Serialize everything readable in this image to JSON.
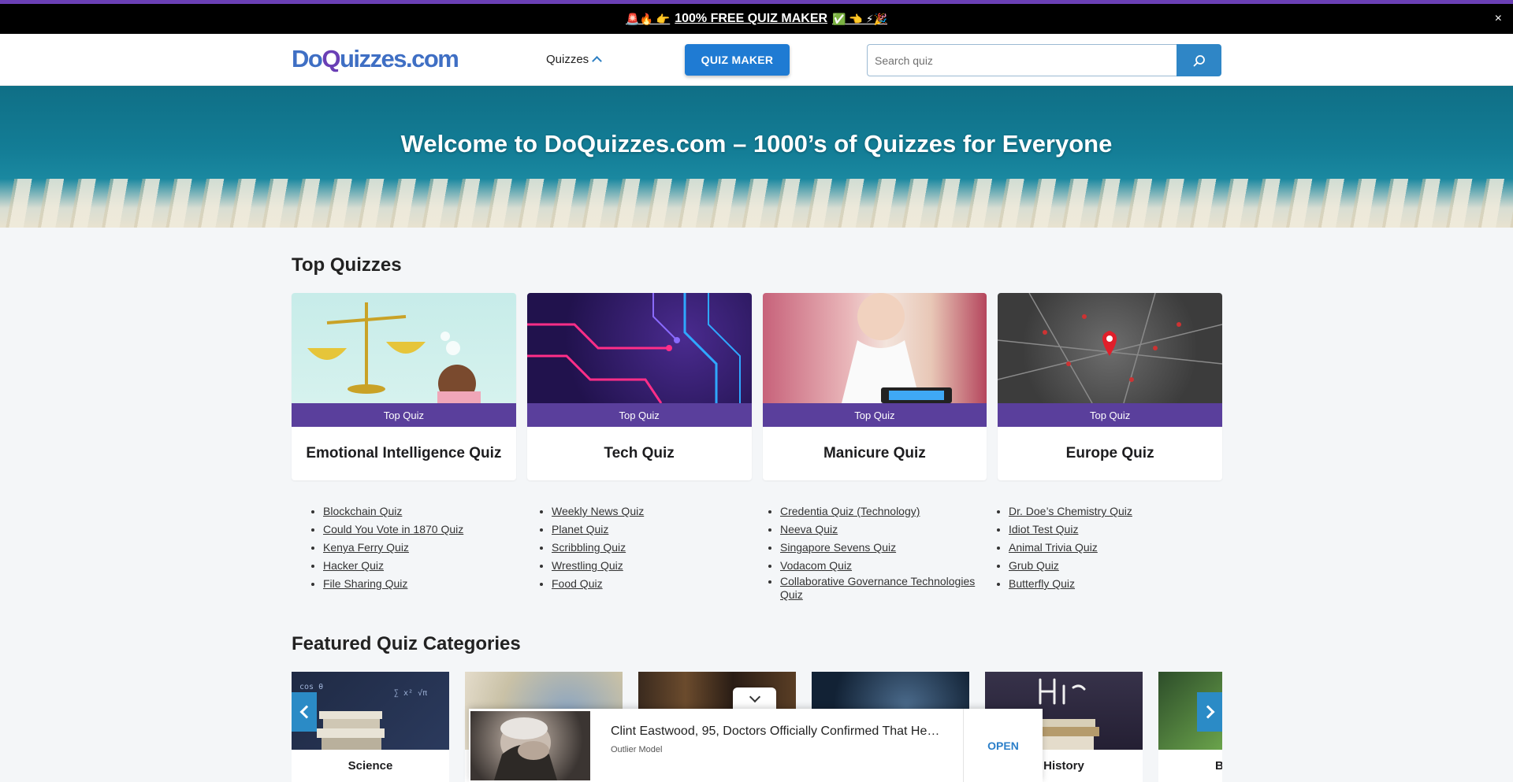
{
  "promo": {
    "emoji_left": "🚨🔥 👉",
    "text": "100% FREE QUIZ MAKER",
    "emoji_right": "✅ 👈 ⚡🎉",
    "close": "×"
  },
  "header": {
    "logo_do": "Do",
    "logo_q": "Q",
    "logo_rest": "uizzes.com",
    "nav_quizzes": "Quizzes",
    "quiz_maker": "QUIZ MAKER",
    "search_placeholder": "Search quiz"
  },
  "hero": {
    "title": "Welcome to DoQuizzes.com – 1000’s of Quizzes for Everyone"
  },
  "top_quizzes": {
    "title": "Top Quizzes",
    "cards": [
      {
        "badge": "Top Quiz",
        "title": "Emotional Intelligence Quiz"
      },
      {
        "badge": "Top Quiz",
        "title": "Tech Quiz"
      },
      {
        "badge": "Top Quiz",
        "title": "Manicure Quiz"
      },
      {
        "badge": "Top Quiz",
        "title": "Europe Quiz"
      }
    ],
    "link_columns": [
      [
        "Blockchain Quiz",
        "Could You Vote in 1870 Quiz",
        "Kenya Ferry Quiz",
        "Hacker Quiz",
        "File Sharing Quiz"
      ],
      [
        "Weekly News Quiz",
        "Planet Quiz",
        "Scribbling Quiz",
        "Wrestling Quiz",
        "Food Quiz"
      ],
      [
        "Credentia Quiz (Technology)",
        "Neeva Quiz",
        "Singapore Sevens Quiz",
        "Vodacom Quiz",
        "Collaborative Governance Technologies Quiz"
      ],
      [
        "Dr. Doe’s Chemistry Quiz",
        "Idiot Test Quiz",
        "Animal Trivia Quiz",
        "Grub Quiz",
        "Butterfly Quiz"
      ]
    ]
  },
  "featured": {
    "title": "Featured Quiz Categories",
    "categories": [
      {
        "label": "Science"
      },
      {
        "label": ""
      },
      {
        "label": ""
      },
      {
        "label": ""
      },
      {
        "label": "History"
      },
      {
        "label": "B"
      }
    ]
  },
  "ad": {
    "headline": "Clint Eastwood, 95, Doctors Officially Confirmed That He…",
    "source": "Outlier Model",
    "cta": "OPEN"
  }
}
